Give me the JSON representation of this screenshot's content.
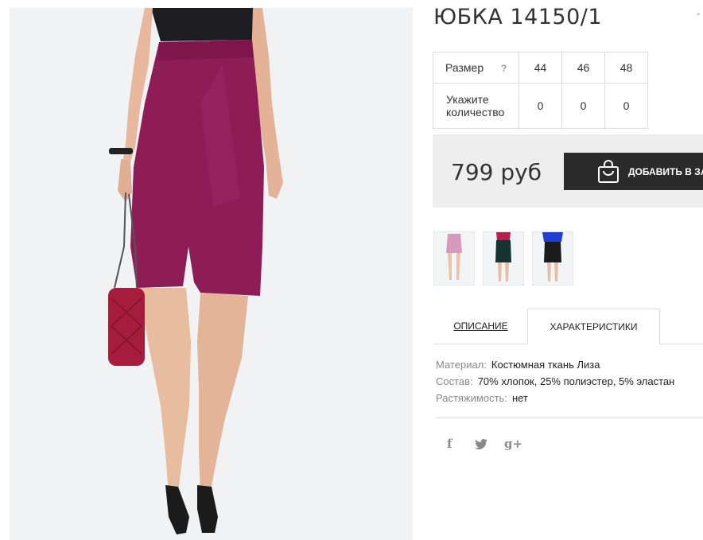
{
  "product": {
    "title": "ЮБКА 14150/1",
    "title_mark": "*"
  },
  "sizes": {
    "size_label": "Размер",
    "help_label": "?",
    "values": [
      "44",
      "46",
      "48"
    ],
    "qty_label": "Укажите количество",
    "quantities": [
      "0",
      "0",
      "0"
    ]
  },
  "purchase": {
    "price": "799 руб",
    "add_to_cart_label": "ДОБАВИТЬ В ЗА",
    "button_color": "#2b2b2b"
  },
  "photo": {
    "skirt_color": "#8e1c57",
    "bag_color": "#a51c3c",
    "background": "#f1f2f4"
  },
  "thumbnails": [
    {
      "icon": "pink-skirt-thumbnail"
    },
    {
      "icon": "green-skirt-thumbnail"
    },
    {
      "icon": "black-skirt-thumbnail"
    }
  ],
  "tabs": {
    "description": "ОПИСАНИЕ",
    "characteristics": "ХАРАКТЕРИСТИКИ",
    "active": "characteristics"
  },
  "specs": [
    {
      "key": "Материал:",
      "value": "Костюмная ткань Лиза"
    },
    {
      "key": "Состав:",
      "value": "70% хлопок, 25% полиэстер, 5% эластан"
    },
    {
      "key": "Растяжимость:",
      "value": "нет"
    }
  ],
  "social": {
    "facebook": "f",
    "twitter": "twitter-bird",
    "googleplus": "g+"
  }
}
